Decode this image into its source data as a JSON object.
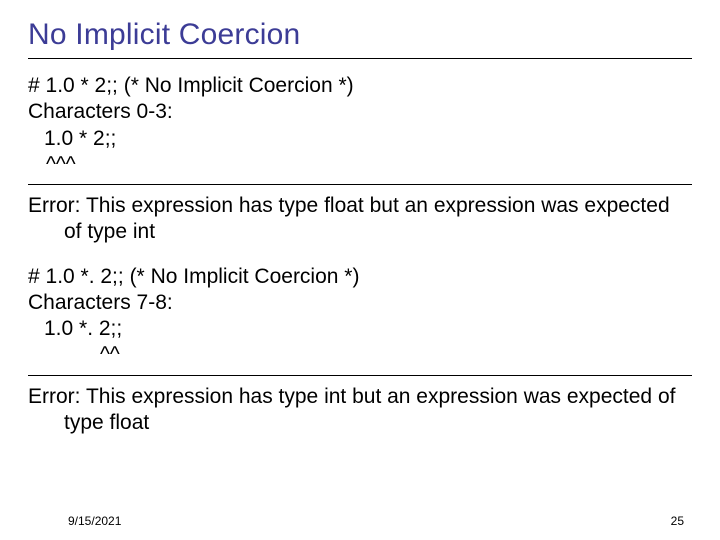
{
  "title": "No Implicit Coercion",
  "block1": {
    "l1": "# 1.0 * 2;; (* No Implicit Coercion *)",
    "l2": "Characters 0-3:",
    "l3": "1.0 * 2;;",
    "l4": "^^^"
  },
  "error1": "Error: This expression has type float but an expression was expected of type int",
  "block2": {
    "l1": "# 1.0 *. 2;; (* No Implicit Coercion *)",
    "l2": "Characters 7-8:",
    "l3": "1.0 *. 2;;",
    "l4": "^^"
  },
  "error2": "Error: This expression has type int but an expression was expected of type float",
  "footer": {
    "date": "9/15/2021",
    "page": "25"
  }
}
